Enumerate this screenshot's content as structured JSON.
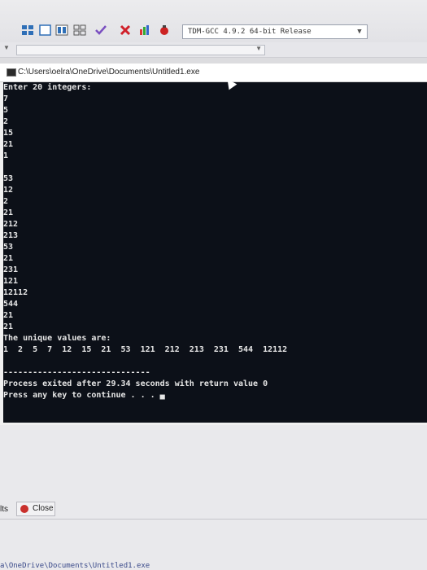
{
  "toolbar": {
    "icons": [
      "window-grid-icon",
      "single-window-icon",
      "tile-icon",
      "tile-grid-icon",
      "check-icon",
      "close-red-icon",
      "chart-icon",
      "debug-icon"
    ],
    "compiler_select": "TDM-GCC 4.9.2 64-bit Release"
  },
  "console": {
    "window_title": "C:\\Users\\oelra\\OneDrive\\Documents\\Untitled1.exe",
    "lines": [
      "Enter 20 integers:",
      "7",
      "5",
      "2",
      "15",
      "21",
      "1",
      "",
      "53",
      "12",
      "2",
      "21",
      "212",
      "213",
      "53",
      "21",
      "231",
      "121",
      "12112",
      "544",
      "21",
      "21",
      "The unique values are:",
      "1  2  5  7  12  15  21  53  121  212  213  231  544  12112",
      "",
      "------------------------------",
      "Process exited after 29.34 seconds with return value 0",
      "Press any key to continue . . . ▄"
    ]
  },
  "bottom": {
    "tab_partial": "lts",
    "close_label": "Close",
    "path_partial": "a\\OneDrive\\Documents\\Untitled1.exe"
  },
  "colors": {
    "console_bg": "#0c1018",
    "console_text": "#e6e6e6"
  }
}
